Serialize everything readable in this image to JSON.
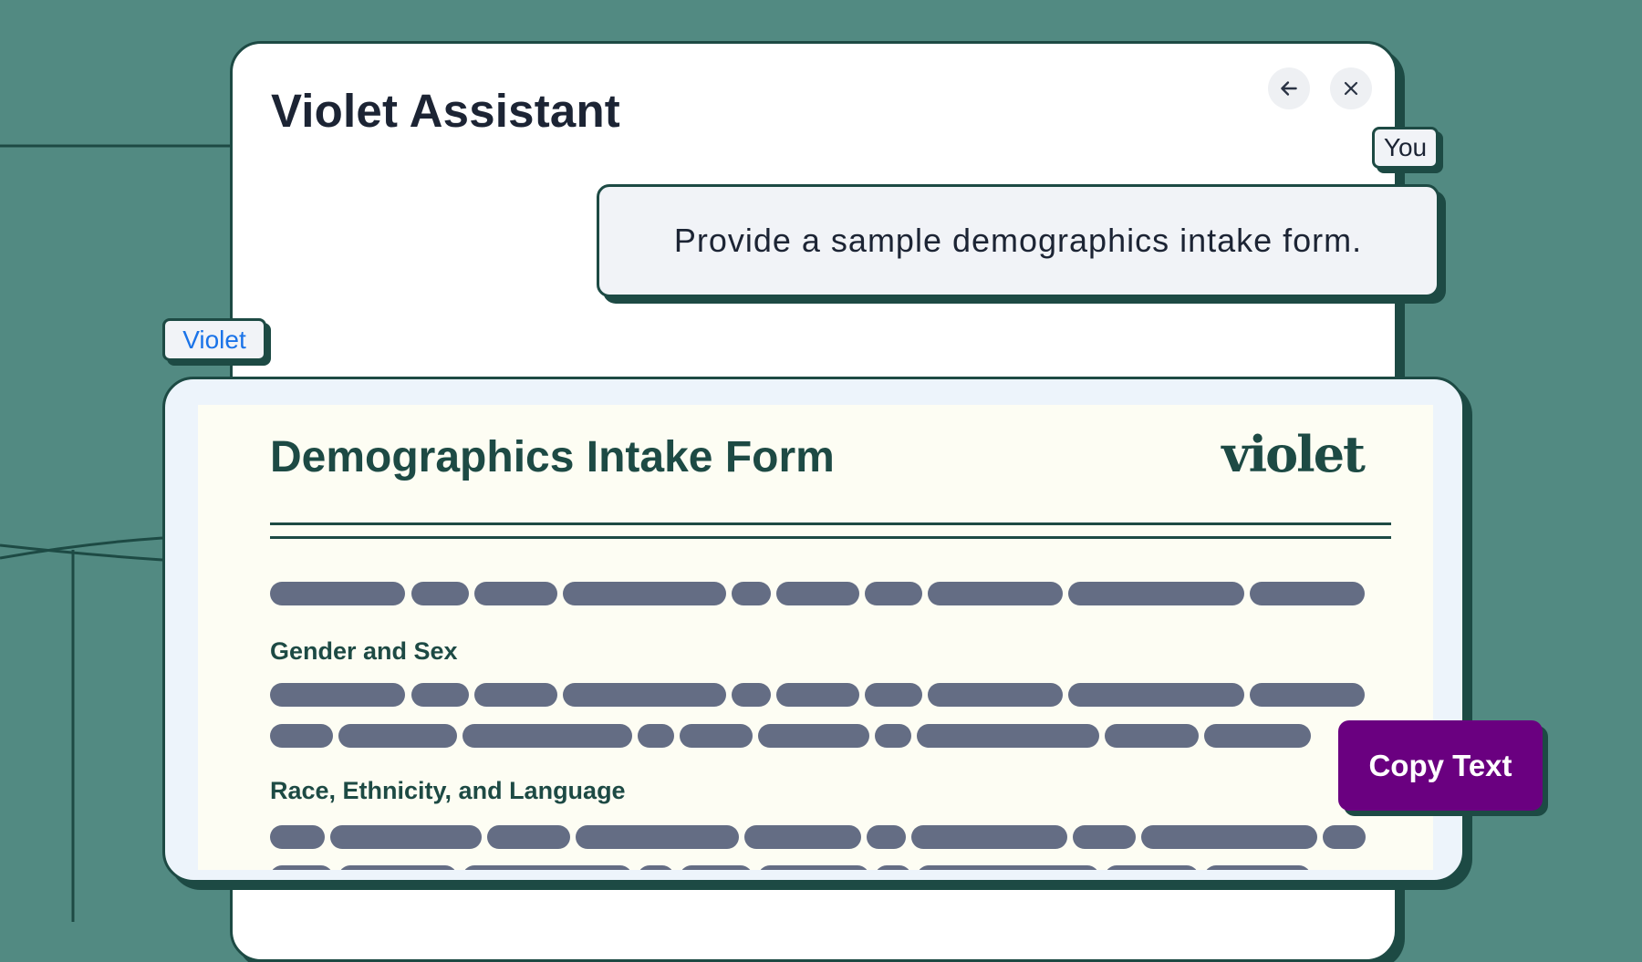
{
  "window": {
    "title": "Violet Assistant",
    "back_icon": "arrow-left-icon",
    "close_icon": "close-icon"
  },
  "chat": {
    "user_tag": "You",
    "user_message": "Provide a sample demographics intake form.",
    "assistant_tag": "Violet"
  },
  "response": {
    "doc_title": "Demographics Intake Form",
    "brand_logo": "violet",
    "sections": [
      {
        "heading": "Gender and Sex"
      },
      {
        "heading": "Race, Ethnicity, and Language"
      }
    ],
    "copy_button": "Copy Text"
  },
  "colors": {
    "background": "#528a82",
    "outline": "#1d4a44",
    "title_text": "#1c2434",
    "assistant_tag_text": "#1a73e8",
    "copy_button": "#6a0080",
    "placeholder_bar": "#646d84",
    "document_bg": "#fdfdf3"
  }
}
